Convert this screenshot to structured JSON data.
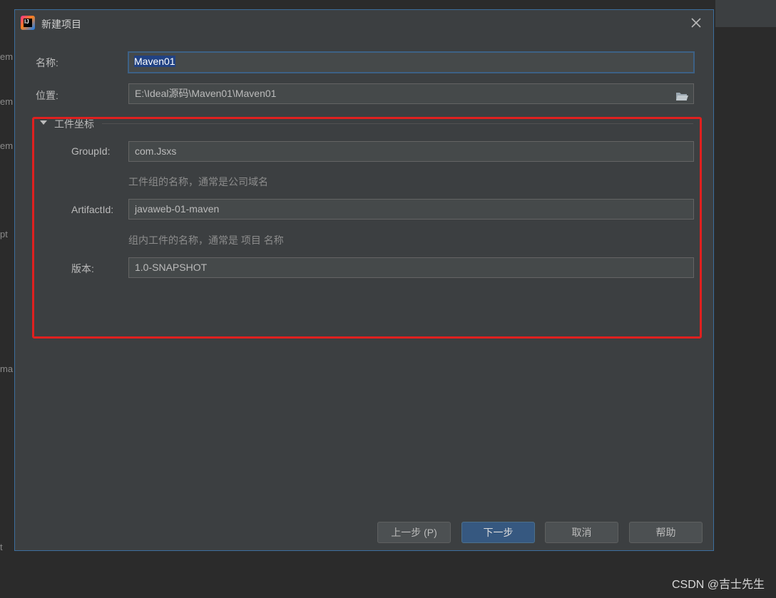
{
  "background": {
    "edge_fragments": [
      "em",
      "em",
      "em",
      "pt",
      "ma",
      "t"
    ]
  },
  "watermark": "CSDN @吉士先生",
  "dialog": {
    "title": "新建项目",
    "name_label": "名称:",
    "name_value": "Maven01",
    "location_label": "位置:",
    "location_value": "E:\\Ideal源码\\Maven01\\Maven01",
    "section": {
      "title": "工件坐标",
      "groupid_label": "GroupId:",
      "groupid_value": "com.Jsxs",
      "groupid_hint": "工件组的名称，通常是公司域名",
      "artifactid_label": "ArtifactId:",
      "artifactid_value": "javaweb-01-maven",
      "artifactid_hint": "组内工件的名称，通常是 项目 名称",
      "version_label": "版本:",
      "version_value": "1.0-SNAPSHOT"
    },
    "buttons": {
      "previous": "上一步 (P)",
      "next": "下一步",
      "cancel": "取消",
      "help": "帮助"
    }
  },
  "colors": {
    "dialog_bg": "#3c3f41",
    "field_bg": "#45494a",
    "selection": "#214283",
    "primary_button": "#365880",
    "highlight_annotation": "#e0201f",
    "app_icon_gradient": [
      "#ff318c",
      "#fc801d",
      "#087cfa"
    ]
  },
  "icons": [
    "intellij-idea-icon",
    "close-icon",
    "folder-icon",
    "expand-arrow-icon"
  ]
}
